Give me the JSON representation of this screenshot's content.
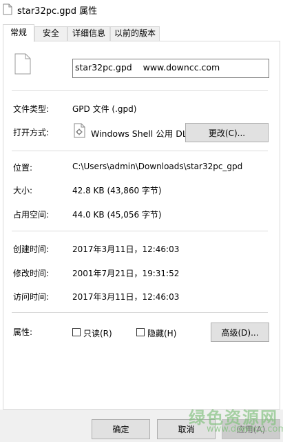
{
  "window": {
    "title": "star32pc.gpd 属性"
  },
  "tabs": [
    "常规",
    "安全",
    "详细信息",
    "以前的版本"
  ],
  "file": {
    "name_field": "star32pc.gpd    www.downcc.com"
  },
  "details": {
    "type_label": "文件类型:",
    "type_value": "GPD 文件 (.gpd)",
    "opens_label": "打开方式:",
    "opens_value": "Windows Shell 公用 DL",
    "change_button": "更改(C)...",
    "location_label": "位置:",
    "location_value": "C:\\Users\\admin\\Downloads\\star32pc_gpd",
    "size_label": "大小:",
    "size_value": "42.8 KB (43,860 字节)",
    "disk_label": "占用空间:",
    "disk_value": "44.0 KB (45,056 字节)",
    "created_label": "创建时间:",
    "created_value": "2017年3月11日，12:46:03",
    "modified_label": "修改时间:",
    "modified_value": "2001年7月21日，19:31:52",
    "accessed_label": "访问时间:",
    "accessed_value": "2017年3月11日，12:46:03",
    "attributes_label": "属性:",
    "readonly_label": "只读(R)",
    "hidden_label": "隐藏(H)",
    "advanced_button": "高级(D)..."
  },
  "footer": {
    "ok": "确定",
    "cancel": "取消",
    "apply": "应用(A)"
  },
  "watermark": {
    "line1": "绿色资源网",
    "line2": "www.downcc.com"
  },
  "colors": {
    "accent": "#0078d7",
    "watermark": "#7ec07a"
  }
}
